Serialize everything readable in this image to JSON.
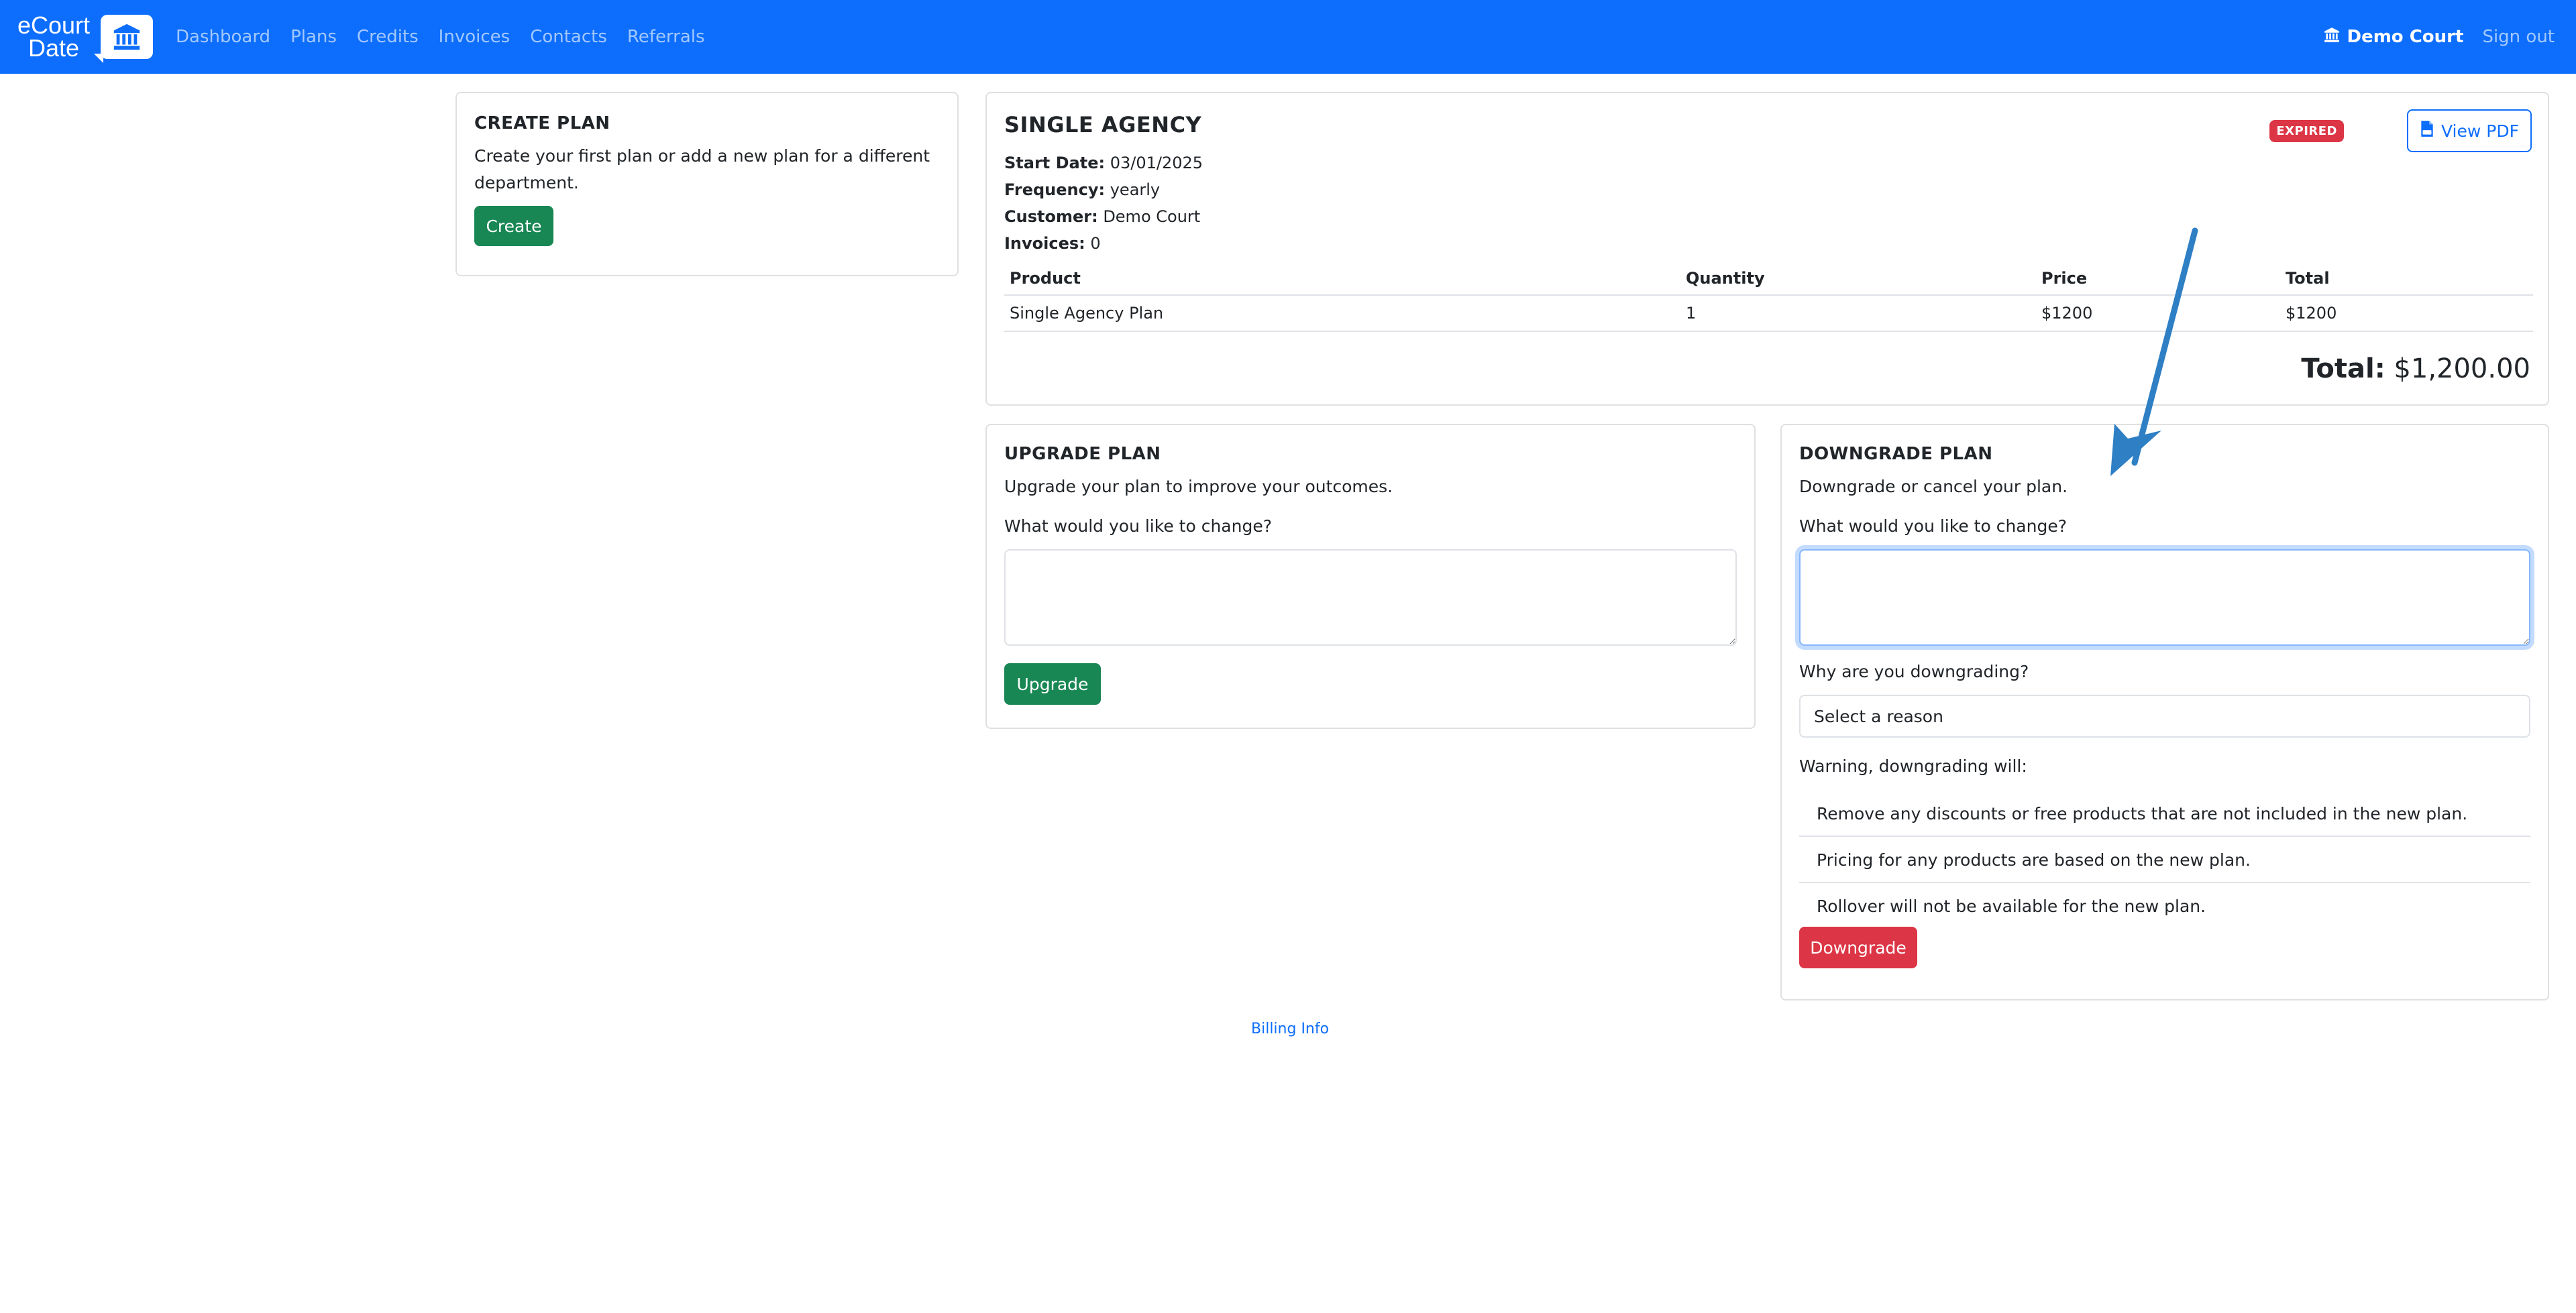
{
  "brand": {
    "line1": "eCourt",
    "line2": "Date",
    "logo_icon": "courthouse-icon"
  },
  "nav": {
    "links": [
      "Dashboard",
      "Plans",
      "Credits",
      "Invoices",
      "Contacts",
      "Referrals"
    ],
    "court_name": "Demo Court",
    "court_icon": "courthouse-icon",
    "signout": "Sign out",
    "bg_color": "#0d6efd"
  },
  "create_plan": {
    "title": "CREATE PLAN",
    "text": "Create your first plan or add a new plan for a different department.",
    "button": "Create"
  },
  "plan": {
    "title": "SINGLE AGENCY",
    "status": "EXPIRED",
    "pdf_button": "View PDF",
    "pdf_icon": "file-pdf-icon",
    "meta": [
      {
        "label": "Start Date:",
        "value": "03/01/2025"
      },
      {
        "label": "Frequency:",
        "value": "yearly"
      },
      {
        "label": "Customer:",
        "value": "Demo Court"
      },
      {
        "label": "Invoices:",
        "value": "0"
      }
    ],
    "table": {
      "headers": [
        "Product",
        "Quantity",
        "Price",
        "Total"
      ],
      "rows": [
        [
          "Single Agency Plan",
          "1",
          "$1200",
          "$1200"
        ]
      ]
    },
    "total_label": "Total:",
    "total_value": "$1,200.00"
  },
  "upgrade": {
    "title": "UPGRADE PLAN",
    "text": "Upgrade your plan to improve your outcomes.",
    "change_label": "What would you like to change?",
    "change_value": "",
    "button": "Upgrade"
  },
  "downgrade": {
    "title": "DOWNGRADE PLAN",
    "text": "Downgrade or cancel your plan.",
    "change_label": "What would you like to change?",
    "change_value": "",
    "reason_label": "Why are you downgrading?",
    "reason_selected": "Select a reason",
    "warning_title": "Warning, downgrading will:",
    "warnings": [
      "Remove any discounts or free products that are not included in the new plan.",
      "Pricing for any products are based on the new plan.",
      "Rollover will not be available for the new plan."
    ],
    "button": "Downgrade"
  },
  "footer": {
    "link": "Billing Info"
  },
  "colors": {
    "primary": "#0d6efd",
    "success": "#198754",
    "danger": "#dc3545",
    "annotation_arrow": "#2e7fc4"
  }
}
